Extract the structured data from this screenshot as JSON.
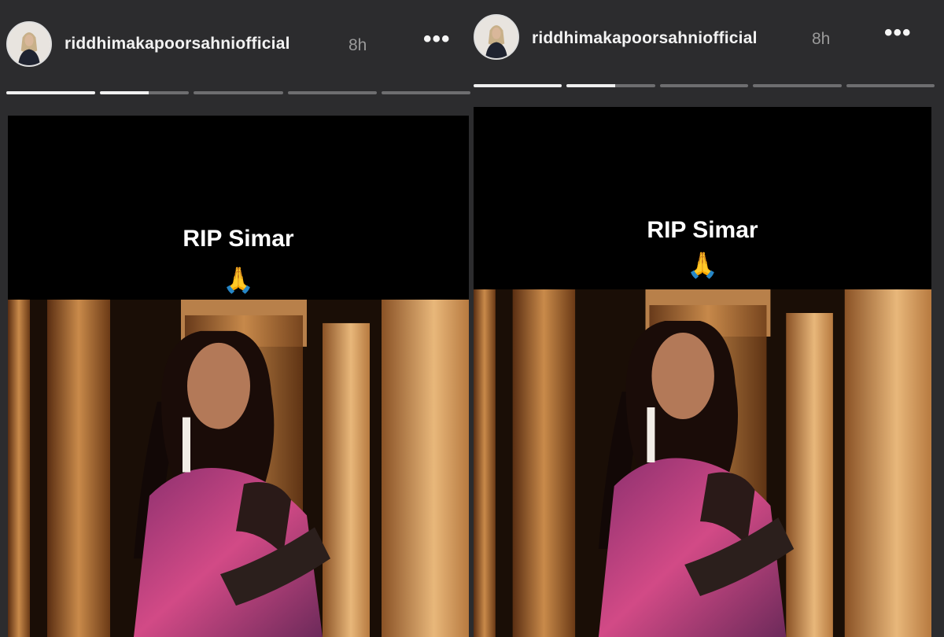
{
  "stories": [
    {
      "username": "riddhimakapoorsahniofficial",
      "time": "8h",
      "more_icon": "more-horizontal-icon",
      "progress": [
        1.0,
        0.55,
        0.0,
        0.0,
        0.0
      ],
      "caption": "RIP Simar",
      "emoji": "🙏",
      "emoji_icon": "folded-hands-icon"
    },
    {
      "username": "riddhimakapoorsahniofficial",
      "time": "8h",
      "more_icon": "more-horizontal-icon",
      "progress": [
        1.0,
        0.55,
        0.0,
        0.0,
        0.0
      ],
      "caption": "RIP Simar",
      "emoji": "🙏",
      "emoji_icon": "folded-hands-icon"
    }
  ],
  "colors": {
    "background": "#2c2c2e",
    "story_bg": "#000000",
    "progress_active": "#f0f0f0",
    "progress_inactive": "#6e6e70",
    "time_gray": "#9a9a9a"
  }
}
